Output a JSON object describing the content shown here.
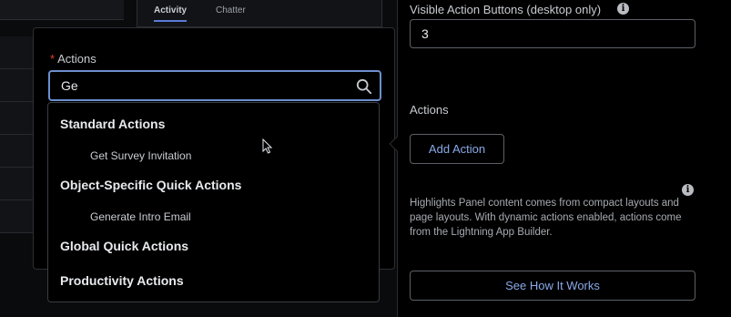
{
  "background": {
    "tabs": [
      {
        "label": "Activity",
        "active": true
      },
      {
        "label": "Chatter",
        "active": false
      }
    ]
  },
  "picker": {
    "label": "Actions",
    "required_marker": "*",
    "search_value": "Ge",
    "groups": [
      {
        "label": "Standard Actions",
        "options": [
          "Get Survey Invitation"
        ]
      },
      {
        "label": "Object-Specific Quick Actions",
        "options": [
          "Generate Intro Email"
        ]
      },
      {
        "label": "Global Quick Actions",
        "options": []
      },
      {
        "label": "Productivity Actions",
        "options": []
      }
    ]
  },
  "properties": {
    "visible_buttons_label": "Visible Action Buttons (desktop only)",
    "visible_buttons_value": "3",
    "actions_label": "Actions",
    "add_action_label": "Add Action",
    "help_text": "Highlights Panel content comes from compact layouts and page layouts. With dynamic actions enabled, actions come from the Lightning App Builder.",
    "see_how_label": "See How It Works"
  },
  "colors": {
    "accent_link": "#89a9e8",
    "focus_border": "#6c8fce",
    "required": "#e0412e"
  },
  "icons": {
    "search": "search-icon",
    "info": "info-icon",
    "cursor": "pointer-cursor-icon"
  }
}
